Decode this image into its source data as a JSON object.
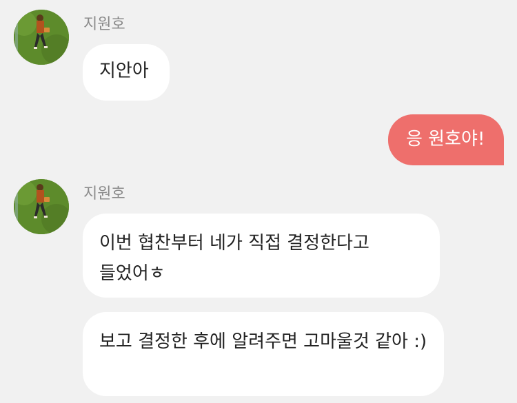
{
  "colors": {
    "background": "#f1f1f1",
    "incoming_bubble": "#ffffff",
    "outgoing_bubble": "#ee6f6c",
    "sender_name_text": "#8a8a8a"
  },
  "avatar_icon": "grass-photo-avatar",
  "messages": [
    {
      "sender": "지원호",
      "text": "지안아"
    },
    {
      "text": "응 원호야!"
    },
    {
      "sender": "지원호",
      "text": "이번 협찬부터 네가 직접 결정한다고 들었어ㅎ"
    },
    {
      "text": "보고 결정한 후에 알려주면 고마울것 같아 :)"
    }
  ]
}
